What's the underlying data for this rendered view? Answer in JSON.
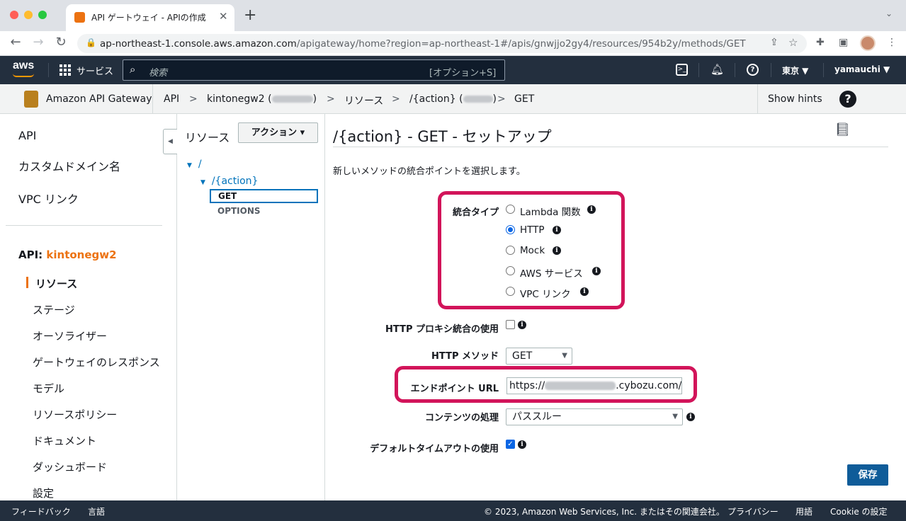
{
  "browser": {
    "tab_title": "API ゲートウェイ - APIの作成",
    "close_glyph": "✕",
    "new_tab_glyph": "+",
    "url_host": "ap-northeast-1.console.aws.amazon.com",
    "url_path": "/apigateway/home?region=ap-northeast-1#/apis/gnwjjo2gy4/resources/954b2y/methods/GET"
  },
  "awsnav": {
    "logo": "aws",
    "services": "サービス",
    "search_placeholder": "検索",
    "search_shortcut": "[オプション+S]",
    "region": "東京 ▼",
    "user": "yamauchi ▼"
  },
  "breadcrumb": {
    "service": "Amazon API Gateway",
    "items": [
      "API",
      "kintonegw2 (",
      "リソース",
      "/{action} (",
      "GET"
    ],
    "separator": ">",
    "show_hints": "Show hints",
    "help_glyph": "?"
  },
  "sidebar": {
    "top_items": [
      "API",
      "カスタムドメイン名",
      "VPC リンク"
    ],
    "api_prefix": "API: ",
    "api_name": "kintonegw2",
    "items": [
      "リソース",
      "ステージ",
      "オーソライザー",
      "ゲートウェイのレスポンス",
      "モデル",
      "リソースポリシー",
      "ドキュメント",
      "ダッシュボード",
      "設定"
    ]
  },
  "tree": {
    "title": "リソース",
    "actions": "アクション ▾",
    "root": "/",
    "action": "/{action}",
    "get": "GET",
    "options": "OPTIONS"
  },
  "main": {
    "title": "/{action} - GET - セットアップ",
    "description": "新しいメソッドの統合ポイントを選択します。",
    "integration_type_label": "統合タイプ",
    "integration_options": [
      "Lambda 関数",
      "HTTP",
      "Mock",
      "AWS サービス",
      "VPC リンク"
    ],
    "selected_integration": "HTTP",
    "proxy_label": "HTTP プロキシ統合の使用",
    "method_label": "HTTP メソッド",
    "method_value": "GET",
    "endpoint_label": "エンドポイント URL",
    "endpoint_prefix": "https://",
    "endpoint_suffix": ".cybozu.com/",
    "content_label": "コンテンツの処理",
    "content_value": "パススルー",
    "timeout_label": "デフォルトタイムアウトの使用",
    "save": "保存",
    "info_glyph": "i"
  },
  "footer": {
    "feedback": "フィードバック",
    "language": "言語",
    "copyright": "© 2023, Amazon Web Services, Inc. またはその関連会社。",
    "privacy": "プライバシー",
    "terms": "用語",
    "cookie": "Cookie の設定"
  },
  "colors": {
    "highlight": "#d2145a",
    "accent_orange": "#ec7211",
    "link_blue": "#0073bb",
    "save_button": "#0f5c99"
  }
}
